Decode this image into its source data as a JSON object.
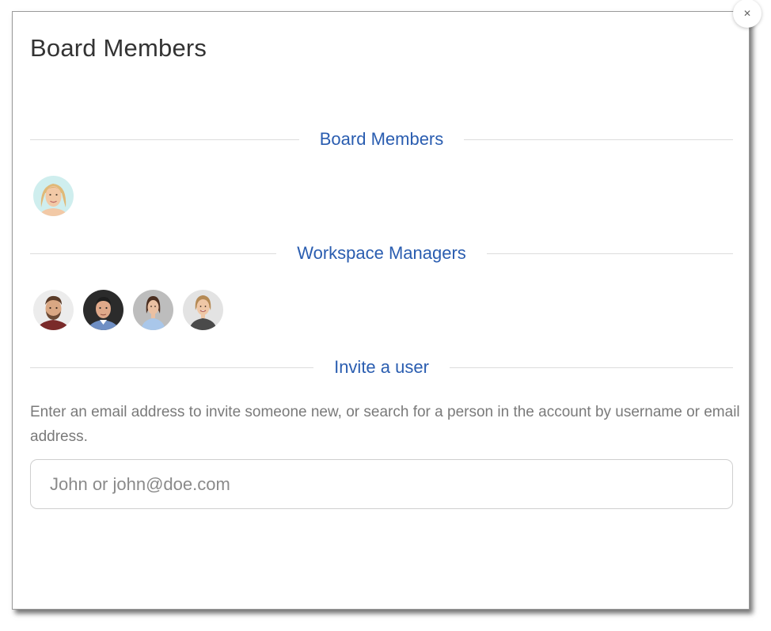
{
  "modal": {
    "title": "Board Members",
    "close_icon": "close-icon"
  },
  "sections": {
    "board_members": {
      "label": "Board Members",
      "members": [
        {
          "avatar": "avatar-woman-blonde",
          "bg": "#cfeeee"
        }
      ]
    },
    "workspace_managers": {
      "label": "Workspace Managers",
      "members": [
        {
          "avatar": "avatar-man-beard",
          "bg": "#e6e6e6"
        },
        {
          "avatar": "avatar-man-dark",
          "bg": "#2c2c2c"
        },
        {
          "avatar": "avatar-woman-brunette",
          "bg": "#bdbdbd"
        },
        {
          "avatar": "avatar-woman-smiling",
          "bg": "#e0e0e0"
        }
      ]
    },
    "invite": {
      "label": "Invite a user",
      "help_text": "Enter an email address to invite someone new, or search for a person in the account by username or email address.",
      "placeholder": "John or john@doe.com",
      "value": ""
    }
  },
  "colors": {
    "accent": "#2a5db0",
    "divider": "#dcdcdc",
    "muted_text": "#7a7a7a"
  }
}
